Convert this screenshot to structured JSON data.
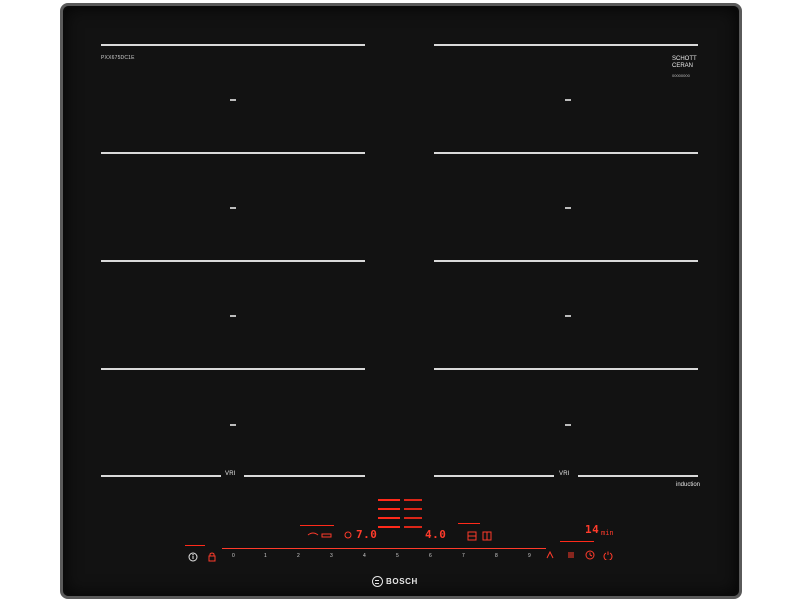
{
  "appliance": {
    "brand": "BOSCH",
    "model_code": "PXX675DC1E",
    "glass_brand_line1": "SCHOTT",
    "glass_brand_line2": "CERAN",
    "glass_code": "00000000",
    "induction_label": "induction",
    "flex_zone_symbol": "VRI"
  },
  "controls": {
    "power_display": "7.0",
    "power_display_2": "4.0",
    "timer_display": "14",
    "timer_unit": "min",
    "slider_scale": [
      "0",
      "1",
      "2",
      "3",
      "4",
      "5",
      "6",
      "7",
      "8",
      "9"
    ]
  },
  "colors": {
    "glass": "#121212",
    "frame": "#5a5a5a",
    "zone_lines": "#d9d9d9",
    "display_red": "#ff3b2b"
  }
}
